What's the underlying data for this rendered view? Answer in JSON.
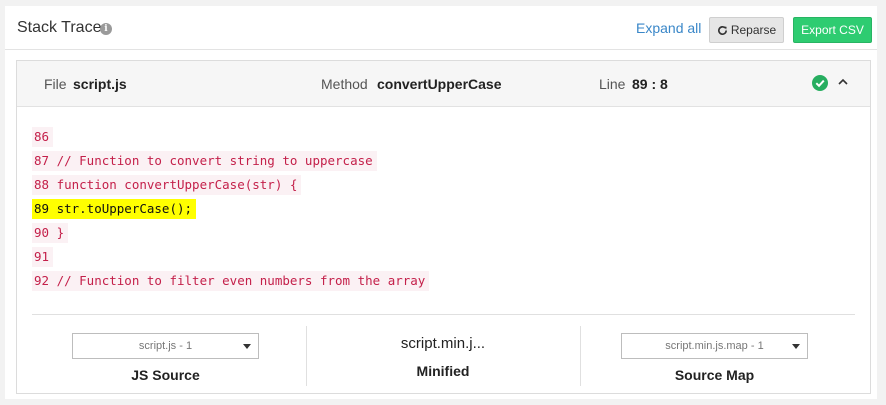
{
  "header": {
    "title": "Stack Trace",
    "info_icon": "info-icon",
    "expand_all_label": "Expand all",
    "reparse_label": "Reparse",
    "export_label": "Export CSV"
  },
  "frame": {
    "file_label": "File",
    "file_value": "script.js",
    "method_label": "Method",
    "method_value": "convertUpperCase",
    "line_label": "Line",
    "line_value": "89 : 8",
    "status_icon": "check-circle-icon",
    "collapse_icon": "chevron-up-icon",
    "code_lines": [
      {
        "text": "86",
        "highlighted": false
      },
      {
        "text": "87 // Function to convert string to uppercase",
        "highlighted": false
      },
      {
        "text": "88 function convertUpperCase(str) {",
        "highlighted": false
      },
      {
        "text": "89 str.toUpperCase();",
        "highlighted": true
      },
      {
        "text": "90 }",
        "highlighted": false
      },
      {
        "text": "91",
        "highlighted": false
      },
      {
        "text": "92 // Function to filter even numbers from the array",
        "highlighted": false
      }
    ]
  },
  "sources": {
    "js_source_select": "script.js - 1",
    "js_source_label": "JS Source",
    "minified_value": "script.min.j...",
    "minified_label": "Minified",
    "source_map_select": "script.min.js.map - 1",
    "source_map_label": "Source Map"
  },
  "colors": {
    "accent_link": "#3a87c8",
    "export_button": "#2ecc71",
    "status_ok": "#27ae60",
    "code_text": "#c4204a",
    "highlight": "#ffff00"
  }
}
